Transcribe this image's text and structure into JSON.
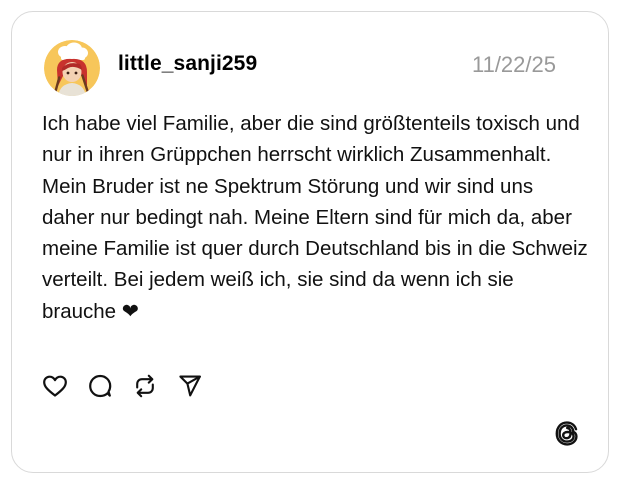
{
  "post": {
    "username": "little_sanji259",
    "date": "11/22/25",
    "text": "Ich habe viel Familie, aber die sind größtenteils toxisch und nur in ihren Grüppchen herrscht wirklich Zusammenhalt. Mein Bruder ist ne Spektrum Störung und wir sind uns daher nur bedingt nah. Meine Eltern sind für mich da, aber meine Familie ist quer durch Deutschland bis in die Schweiz verteilt. Bei jedem weiß ich, sie sind da wenn ich sie brauche ❤"
  },
  "actions": {
    "items": [
      {
        "name": "like",
        "icon": "heart-icon"
      },
      {
        "name": "reply",
        "icon": "speech-bubble-icon"
      },
      {
        "name": "repost",
        "icon": "repost-arrows-icon"
      },
      {
        "name": "share",
        "icon": "paper-plane-icon"
      }
    ]
  },
  "branding": {
    "logo_icon": "threads-logo-icon"
  },
  "colors": {
    "card_border": "#d9d9d9",
    "date_text": "#999999",
    "body_text": "#111111"
  }
}
